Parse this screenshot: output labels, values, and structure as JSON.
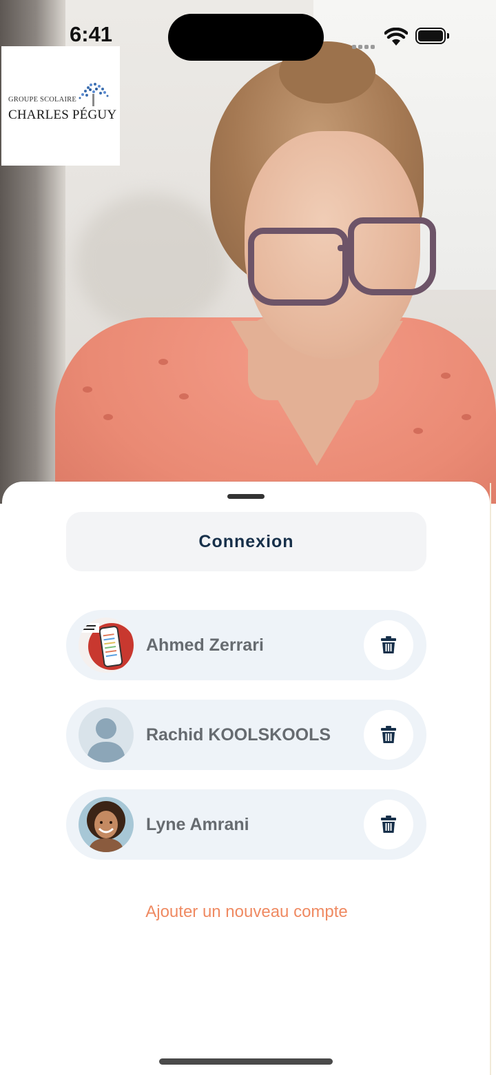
{
  "status_bar": {
    "time": "6:41"
  },
  "logo": {
    "line1": "GROUPE SCOLAIRE",
    "line2": "CHARLES PÉGUY"
  },
  "sheet": {
    "title": "Connexion",
    "accounts": [
      {
        "name": "Ahmed Zerrari",
        "avatar": "app-promo-thumbnail"
      },
      {
        "name": "Rachid KOOLSKOOLS",
        "avatar": "default-user-placeholder"
      },
      {
        "name": "Lyne Amrani",
        "avatar": "child-photo"
      }
    ],
    "add_account_label": "Ajouter un nouveau compte"
  },
  "colors": {
    "title_text": "#17304a",
    "account_bg": "#eef3f8",
    "trash_icon": "#17304a",
    "add_link": "#ef8a62"
  }
}
